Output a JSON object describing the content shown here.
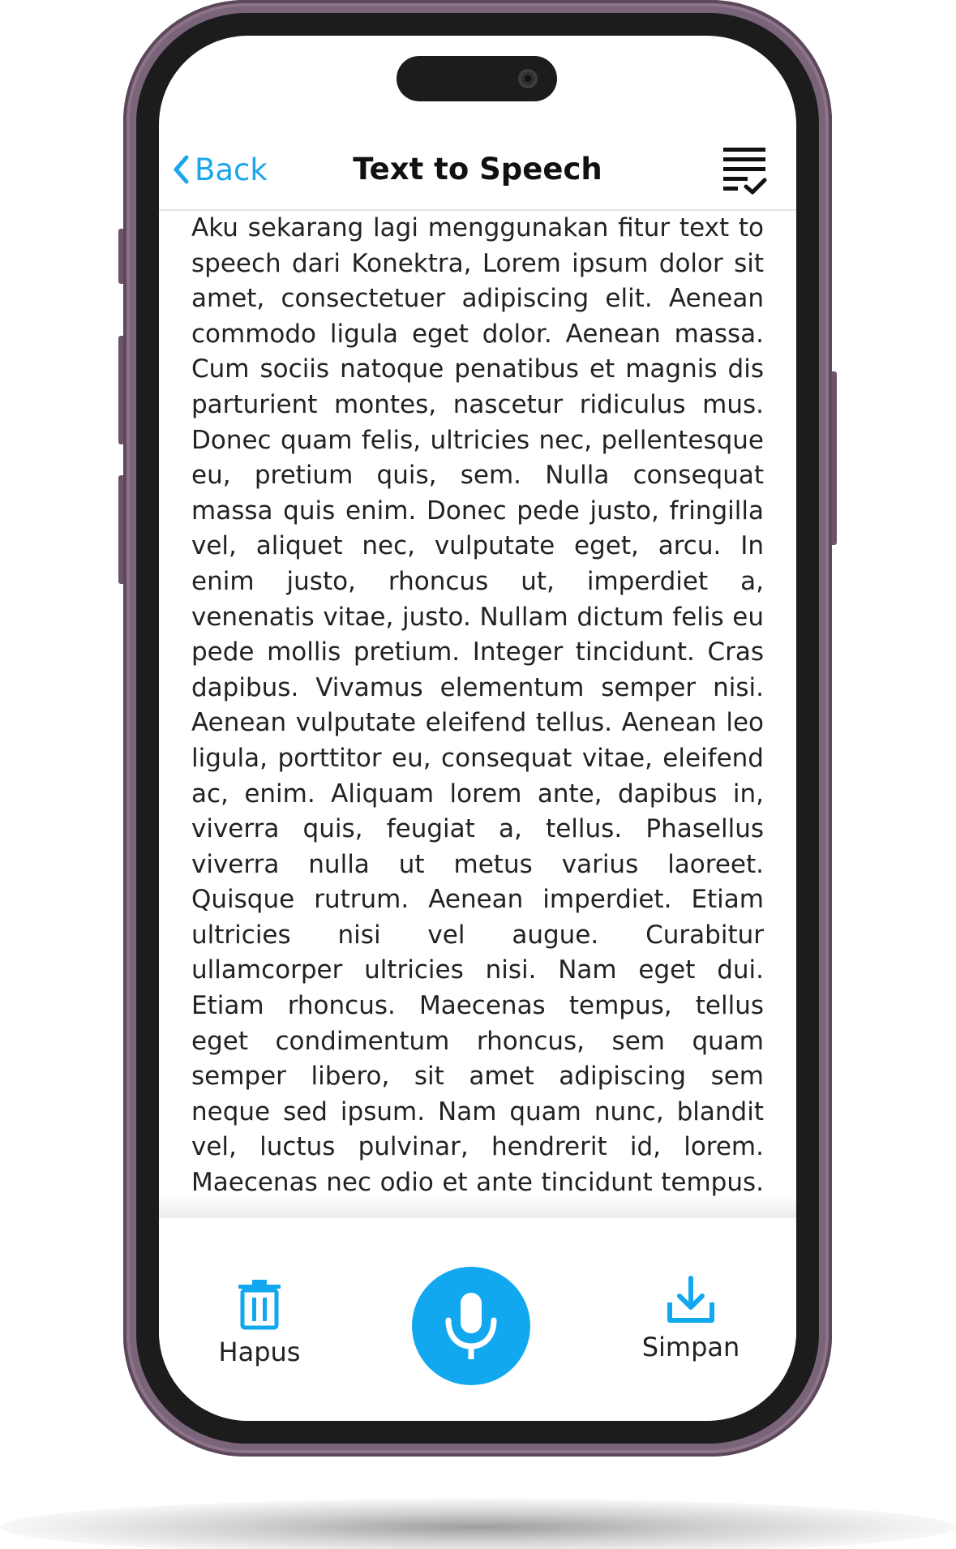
{
  "nav": {
    "back_label": "Back",
    "title": "Text to Speech"
  },
  "content": {
    "text": "Aku sekarang lagi menggunakan fitur text to speech dari Konektra, Lorem ipsum dolor sit amet, consectetuer adipiscing elit. Aenean commodo ligula eget dolor. Aenean massa. Cum sociis natoque penatibus et magnis dis parturient montes, nascetur ridiculus mus. Donec quam felis, ultricies nec, pellentesque eu, pretium quis, sem. Nulla consequat massa quis enim. Donec pede justo, fringilla vel, aliquet nec, vulputate eget, arcu. In enim justo, rhoncus ut, imperdiet a, venenatis vitae, justo. Nullam dictum felis eu pede mollis pretium. Integer tincidunt. Cras dapibus. Vivamus elementum semper nisi. Aenean vulputate eleifend tellus. Aenean leo ligula, porttitor eu, consequat vitae, eleifend ac, enim. Aliquam lorem ante, dapibus in, viverra quis, feugiat a, tellus. Phasellus viverra nulla ut metus varius laoreet. Quisque rutrum. Aenean imperdiet. Etiam ultricies nisi vel augue. Curabitur ullamcorper ultricies nisi. Nam eget dui. Etiam rhoncus. Maecenas tempus, tellus eget condimentum rhoncus, sem quam semper libero, sit amet adipiscing sem neque sed ipsum. Nam quam nunc, blandit vel, luctus pulvinar, hendrerit id, lorem. Maecenas nec odio et ante tincidunt tempus. Donec vitae s"
  },
  "toolbar": {
    "delete_label": "Hapus",
    "save_label": "Simpan",
    "mic_icon": "microphone-icon",
    "delete_icon": "trash-icon",
    "save_icon": "download-icon"
  },
  "colors": {
    "accent": "#12a8ef",
    "link": "#1aa6ea",
    "frame": "#7a6479",
    "bezel": "#1c1c1c"
  }
}
